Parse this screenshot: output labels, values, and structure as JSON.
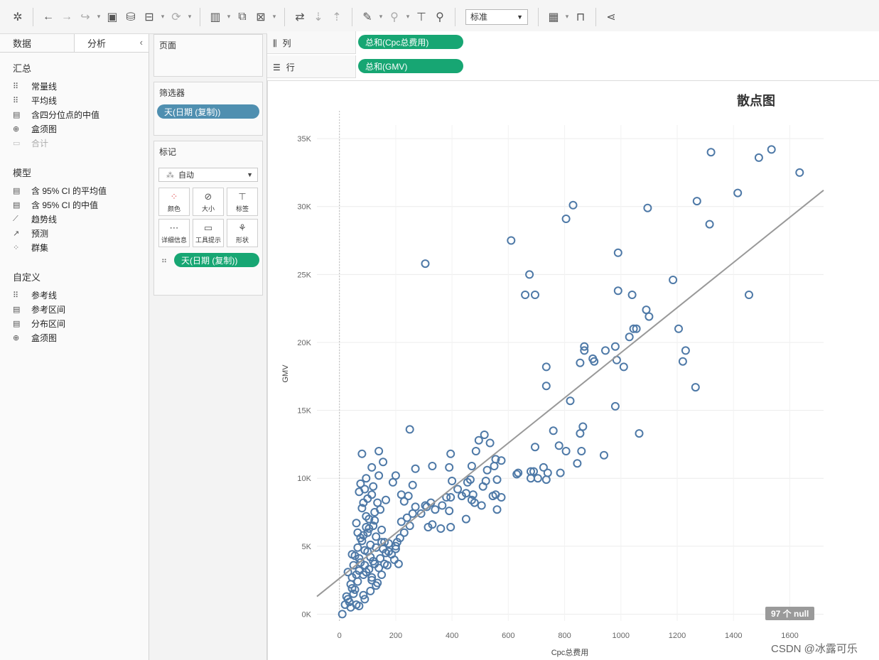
{
  "toolbar": {
    "fit_label": "标准",
    "icons": [
      "tableau-logo-icon",
      "back-icon",
      "forward-icon",
      "redo-icon",
      "save-icon",
      "new-datasource-icon",
      "pause-updates-icon",
      "refresh-icon",
      "new-sheet-icon",
      "duplicate-sheet-icon",
      "clear-sheet-icon",
      "swap-icon",
      "sort-asc-icon",
      "sort-desc-icon",
      "highlight-icon",
      "group-icon",
      "label-icon",
      "pin-icon",
      "show-me-icon",
      "presentation-icon",
      "share-icon"
    ]
  },
  "left_pane": {
    "tabs": [
      {
        "label": "数据"
      },
      {
        "label": "分析"
      }
    ],
    "sections": {
      "summary": {
        "title": "汇总",
        "items": [
          "常量线",
          "平均线",
          "含四分位点的中值",
          "盒须图",
          "合计"
        ]
      },
      "model": {
        "title": "模型",
        "items": [
          "含 95% CI 的平均值",
          "含 95% CI 的中值",
          "趋势线",
          "预测",
          "群集"
        ]
      },
      "custom": {
        "title": "自定义",
        "items": [
          "参考线",
          "参考区间",
          "分布区间",
          "盒须图"
        ]
      }
    }
  },
  "cards": {
    "pages_title": "页面",
    "filters_title": "筛选器",
    "filter_pill": "天(日期 (复制))",
    "marks_title": "标记",
    "marks_type": "自动",
    "mark_buttons": [
      "颜色",
      "大小",
      "标签",
      "详细信息",
      "工具提示",
      "形状"
    ],
    "detail_pill": "天(日期 (复制))"
  },
  "shelves": {
    "columns_label": "列",
    "columns_pill": "总和(Cpc总费用)",
    "rows_label": "行",
    "rows_pill": "总和(GMV)"
  },
  "chart_data": {
    "type": "scatter",
    "title": "散点图",
    "xlabel": "Cpc总费用",
    "ylabel": "GMV",
    "xlim": [
      -80,
      1720
    ],
    "ylim": [
      -500,
      36000
    ],
    "x_ticks": [
      0,
      200,
      400,
      600,
      800,
      1000,
      1200,
      1400,
      1600
    ],
    "x_tick_labels": [
      "0",
      "200",
      "400",
      "600",
      "800",
      "1000",
      "1200",
      "1400",
      "1600"
    ],
    "y_ticks": [
      0,
      5000,
      10000,
      15000,
      20000,
      25000,
      30000,
      35000
    ],
    "y_tick_labels": [
      "0K",
      "5K",
      "10K",
      "15K",
      "20K",
      "25K",
      "30K",
      "35K"
    ],
    "grid": true,
    "point_color": "#4e79a7",
    "trend_line": {
      "x": [
        -80,
        1720
      ],
      "y": [
        1300,
        31200
      ],
      "color": "#999999"
    },
    "null_badge": "97 个 null",
    "points": [
      [
        1535,
        34200
      ],
      [
        1320,
        34000
      ],
      [
        1490,
        33600
      ],
      [
        1635,
        32500
      ],
      [
        1415,
        31000
      ],
      [
        1270,
        30400
      ],
      [
        830,
        30100
      ],
      [
        1095,
        29900
      ],
      [
        805,
        29100
      ],
      [
        1315,
        28700
      ],
      [
        610,
        27500
      ],
      [
        990,
        26600
      ],
      [
        305,
        25800
      ],
      [
        675,
        25000
      ],
      [
        1185,
        24600
      ],
      [
        990,
        23800
      ],
      [
        660,
        23500
      ],
      [
        695,
        23500
      ],
      [
        1040,
        23500
      ],
      [
        1455,
        23500
      ],
      [
        1090,
        22400
      ],
      [
        1100,
        21900
      ],
      [
        1045,
        21000
      ],
      [
        1055,
        21000
      ],
      [
        1205,
        21000
      ],
      [
        1030,
        20400
      ],
      [
        870,
        19700
      ],
      [
        980,
        19700
      ],
      [
        870,
        19400
      ],
      [
        1230,
        19400
      ],
      [
        945,
        19400
      ],
      [
        900,
        18800
      ],
      [
        905,
        18600
      ],
      [
        985,
        18700
      ],
      [
        855,
        18500
      ],
      [
        1220,
        18600
      ],
      [
        735,
        18200
      ],
      [
        1010,
        18200
      ],
      [
        735,
        16800
      ],
      [
        1265,
        16700
      ],
      [
        820,
        15700
      ],
      [
        980,
        15300
      ],
      [
        1065,
        13300
      ],
      [
        760,
        13500
      ],
      [
        865,
        13800
      ],
      [
        855,
        13300
      ],
      [
        250,
        13600
      ],
      [
        515,
        13200
      ],
      [
        495,
        12800
      ],
      [
        485,
        12000
      ],
      [
        805,
        12000
      ],
      [
        860,
        12000
      ],
      [
        780,
        12400
      ],
      [
        695,
        12300
      ],
      [
        535,
        12600
      ],
      [
        140,
        12000
      ],
      [
        80,
        11800
      ],
      [
        395,
        11800
      ],
      [
        155,
        11200
      ],
      [
        940,
        11700
      ],
      [
        330,
        10900
      ],
      [
        270,
        10700
      ],
      [
        390,
        10800
      ],
      [
        470,
        10900
      ],
      [
        525,
        10600
      ],
      [
        550,
        10900
      ],
      [
        555,
        11400
      ],
      [
        575,
        11300
      ],
      [
        845,
        11100
      ],
      [
        725,
        10800
      ],
      [
        680,
        10500
      ],
      [
        690,
        10500
      ],
      [
        740,
        10400
      ],
      [
        785,
        10400
      ],
      [
        635,
        10400
      ],
      [
        630,
        10300
      ],
      [
        455,
        9700
      ],
      [
        520,
        9800
      ],
      [
        560,
        9900
      ],
      [
        680,
        10000
      ],
      [
        705,
        10000
      ],
      [
        735,
        9900
      ],
      [
        465,
        9900
      ],
      [
        400,
        9800
      ],
      [
        420,
        9200
      ],
      [
        510,
        9400
      ],
      [
        435,
        8700
      ],
      [
        450,
        8900
      ],
      [
        475,
        8800
      ],
      [
        555,
        8800
      ],
      [
        575,
        8600
      ],
      [
        545,
        8700
      ],
      [
        470,
        8400
      ],
      [
        480,
        8200
      ],
      [
        505,
        8000
      ],
      [
        380,
        8600
      ],
      [
        395,
        8600
      ],
      [
        305,
        8000
      ],
      [
        325,
        8200
      ],
      [
        310,
        7900
      ],
      [
        340,
        7700
      ],
      [
        365,
        8000
      ],
      [
        390,
        7600
      ],
      [
        450,
        7000
      ],
      [
        560,
        7700
      ],
      [
        315,
        6400
      ],
      [
        330,
        6600
      ],
      [
        360,
        6300
      ],
      [
        395,
        6400
      ],
      [
        290,
        7400
      ],
      [
        240,
        7100
      ],
      [
        230,
        8300
      ],
      [
        220,
        8800
      ],
      [
        220,
        6800
      ],
      [
        205,
        5300
      ],
      [
        200,
        4800
      ],
      [
        160,
        5300
      ],
      [
        175,
        4600
      ],
      [
        120,
        6500
      ],
      [
        100,
        6000
      ],
      [
        210,
        3700
      ],
      [
        160,
        3700
      ],
      [
        115,
        2500
      ],
      [
        85,
        1400
      ],
      [
        60,
        700
      ],
      [
        40,
        500
      ],
      [
        20,
        700
      ],
      [
        10,
        0
      ],
      [
        30,
        1100
      ],
      [
        55,
        1800
      ],
      [
        45,
        2700
      ],
      [
        70,
        3200
      ],
      [
        90,
        3600
      ],
      [
        110,
        4200
      ],
      [
        130,
        4900
      ],
      [
        150,
        5300
      ],
      [
        75,
        5600
      ],
      [
        95,
        6400
      ],
      [
        105,
        7000
      ],
      [
        125,
        7500
      ],
      [
        135,
        8200
      ],
      [
        115,
        8800
      ],
      [
        90,
        9200
      ],
      [
        70,
        9000
      ],
      [
        85,
        8200
      ],
      [
        95,
        7200
      ],
      [
        65,
        6000
      ],
      [
        80,
        5400
      ],
      [
        100,
        4600
      ],
      [
        120,
        3900
      ],
      [
        140,
        3400
      ],
      [
        60,
        2900
      ],
      [
        40,
        2200
      ],
      [
        50,
        1500
      ],
      [
        35,
        900
      ],
      [
        25,
        1300
      ],
      [
        45,
        1900
      ],
      [
        65,
        2400
      ],
      [
        85,
        2900
      ],
      [
        105,
        3300
      ],
      [
        125,
        3700
      ],
      [
        145,
        4100
      ],
      [
        165,
        4500
      ],
      [
        55,
        4300
      ],
      [
        75,
        3800
      ],
      [
        95,
        3100
      ],
      [
        115,
        2700
      ],
      [
        135,
        2300
      ],
      [
        155,
        4800
      ],
      [
        175,
        5200
      ],
      [
        185,
        4400
      ],
      [
        195,
        4000
      ],
      [
        170,
        3600
      ],
      [
        150,
        2900
      ],
      [
        130,
        2100
      ],
      [
        110,
        1700
      ],
      [
        90,
        1100
      ],
      [
        70,
        600
      ],
      [
        45,
        4400
      ],
      [
        65,
        4900
      ],
      [
        85,
        5800
      ],
      [
        105,
        6300
      ],
      [
        125,
        6900
      ],
      [
        145,
        7700
      ],
      [
        165,
        8400
      ],
      [
        60,
        6700
      ],
      [
        80,
        7800
      ],
      [
        100,
        8500
      ],
      [
        120,
        9400
      ],
      [
        140,
        10200
      ],
      [
        75,
        9600
      ],
      [
        95,
        10000
      ],
      [
        115,
        10800
      ],
      [
        30,
        3100
      ],
      [
        50,
        3600
      ],
      [
        70,
        4100
      ],
      [
        90,
        4700
      ],
      [
        110,
        5100
      ],
      [
        130,
        5700
      ],
      [
        150,
        6200
      ],
      [
        200,
        5000
      ],
      [
        215,
        5600
      ],
      [
        230,
        6000
      ],
      [
        250,
        6500
      ],
      [
        260,
        7400
      ],
      [
        270,
        7900
      ],
      [
        245,
        8700
      ],
      [
        260,
        9500
      ],
      [
        190,
        9700
      ],
      [
        200,
        10200
      ]
    ]
  },
  "watermark": "CSDN @冰露可乐"
}
